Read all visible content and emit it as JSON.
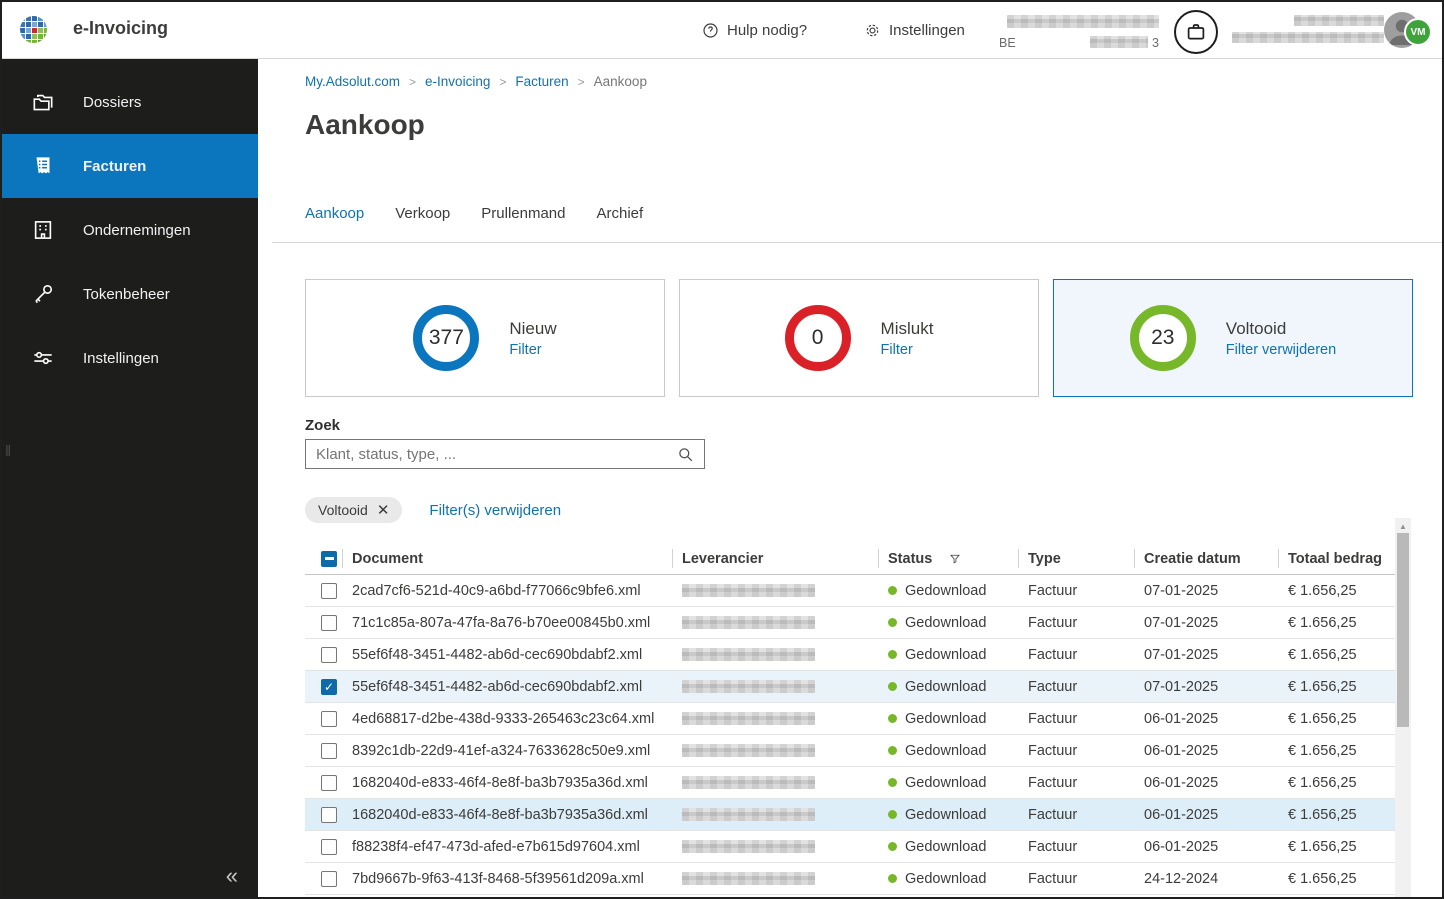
{
  "app": {
    "title": "e-Invoicing"
  },
  "header": {
    "help_label": "Hulp nodig?",
    "settings_label": "Instellingen",
    "company_vat_prefix": "BE",
    "company_vat_suffix": "3",
    "avatar_badge": "VM"
  },
  "sidebar": {
    "items": [
      {
        "label": "Dossiers",
        "icon": "folders-icon",
        "active": false
      },
      {
        "label": "Facturen",
        "icon": "invoice-icon",
        "active": true
      },
      {
        "label": "Ondernemingen",
        "icon": "building-icon",
        "active": false
      },
      {
        "label": "Tokenbeheer",
        "icon": "key-icon",
        "active": false
      },
      {
        "label": "Instellingen",
        "icon": "sliders-icon",
        "active": false
      }
    ],
    "collapse_glyph": "«"
  },
  "breadcrumb": {
    "items": [
      "My.Adsolut.com",
      "e-Invoicing",
      "Facturen",
      "Aankoop"
    ]
  },
  "page": {
    "title": "Aankoop"
  },
  "tabs": [
    {
      "label": "Aankoop",
      "active": true
    },
    {
      "label": "Verkoop",
      "active": false
    },
    {
      "label": "Prullenmand",
      "active": false
    },
    {
      "label": "Archief",
      "active": false
    }
  ],
  "stats": [
    {
      "count": "377",
      "label": "Nieuw",
      "action": "Filter",
      "color": "#0b76be",
      "selected": false
    },
    {
      "count": "0",
      "label": "Mislukt",
      "action": "Filter",
      "color": "#da2128",
      "selected": false
    },
    {
      "count": "23",
      "label": "Voltooid",
      "action": "Filter verwijderen",
      "color": "#76b82a",
      "selected": true
    }
  ],
  "search": {
    "label": "Zoek",
    "placeholder": "Klant, status, type, ..."
  },
  "filters": {
    "chip": "Voltooid",
    "chip_close": "✕",
    "clear_all": "Filter(s) verwijderen"
  },
  "table": {
    "columns": [
      "Document",
      "Leverancier",
      "Status",
      "Type",
      "Creatie datum",
      "Totaal bedrag"
    ],
    "supplier_redacted": true,
    "rows": [
      {
        "document": "2cad7cf6-521d-40c9-a6bd-f77066c9bfe6.xml",
        "status": "Gedownload",
        "type": "Factuur",
        "date": "07-01-2025",
        "amount": "€ 1.656,25",
        "checked": false,
        "highlight": false
      },
      {
        "document": "71c1c85a-807a-47fa-8a76-b70ee00845b0.xml",
        "status": "Gedownload",
        "type": "Factuur",
        "date": "07-01-2025",
        "amount": "€ 1.656,25",
        "checked": false,
        "highlight": false
      },
      {
        "document": "55ef6f48-3451-4482-ab6d-cec690bdabf2.xml",
        "status": "Gedownload",
        "type": "Factuur",
        "date": "07-01-2025",
        "amount": "€ 1.656,25",
        "checked": false,
        "highlight": false
      },
      {
        "document": "55ef6f48-3451-4482-ab6d-cec690bdabf2.xml",
        "status": "Gedownload",
        "type": "Factuur",
        "date": "07-01-2025",
        "amount": "€ 1.656,25",
        "checked": true,
        "highlight": false
      },
      {
        "document": "4ed68817-d2be-438d-9333-265463c23c64.xml",
        "status": "Gedownload",
        "type": "Factuur",
        "date": "06-01-2025",
        "amount": "€ 1.656,25",
        "checked": false,
        "highlight": false
      },
      {
        "document": "8392c1db-22d9-41ef-a324-7633628c50e9.xml",
        "status": "Gedownload",
        "type": "Factuur",
        "date": "06-01-2025",
        "amount": "€ 1.656,25",
        "checked": false,
        "highlight": false
      },
      {
        "document": "1682040d-e833-46f4-8e8f-ba3b7935a36d.xml",
        "status": "Gedownload",
        "type": "Factuur",
        "date": "06-01-2025",
        "amount": "€ 1.656,25",
        "checked": false,
        "highlight": false
      },
      {
        "document": "1682040d-e833-46f4-8e8f-ba3b7935a36d.xml",
        "status": "Gedownload",
        "type": "Factuur",
        "date": "06-01-2025",
        "amount": "€ 1.656,25",
        "checked": false,
        "highlight": true
      },
      {
        "document": "f88238f4-ef47-473d-afed-e7b615d97604.xml",
        "status": "Gedownload",
        "type": "Factuur",
        "date": "06-01-2025",
        "amount": "€ 1.656,25",
        "checked": false,
        "highlight": false
      },
      {
        "document": "7bd9667b-9f63-413f-8468-5f39561d209a.xml",
        "status": "Gedownload",
        "type": "Factuur",
        "date": "24-12-2024",
        "amount": "€ 1.656,25",
        "checked": false,
        "highlight": false
      }
    ]
  },
  "colors": {
    "accent": "#0b76be",
    "link": "#0f73ae",
    "danger": "#da2128",
    "success": "#76b82a",
    "sidebar_bg": "#1d1d1b"
  }
}
